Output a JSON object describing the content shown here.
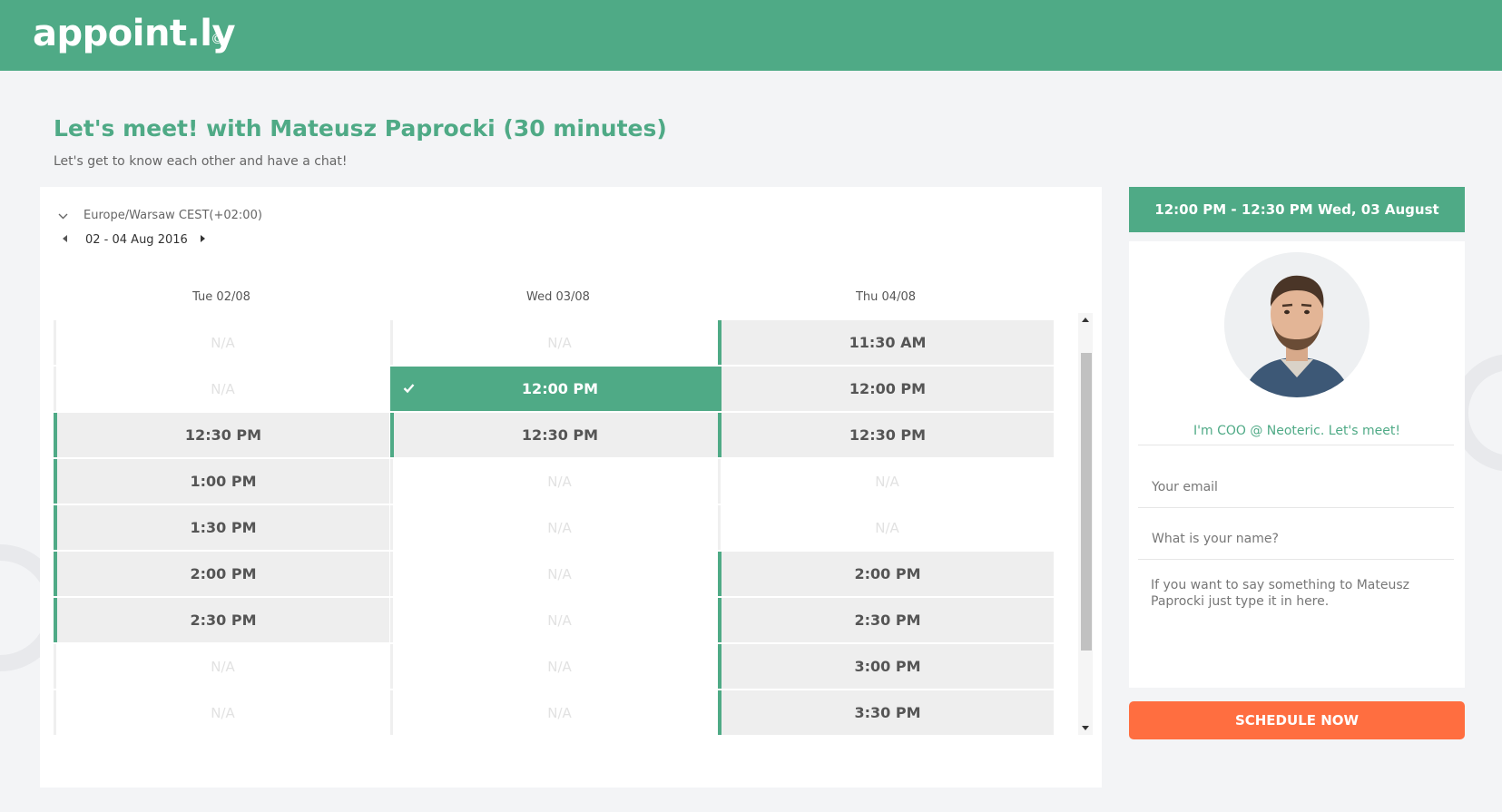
{
  "header": {
    "logo_text": "appoint.ly",
    "logo_mark": "©"
  },
  "page": {
    "title": "Let's meet! with Mateusz Paprocki (30 minutes)",
    "subtitle": "Let's get to know each other and have a chat!"
  },
  "calendar": {
    "timezone": "Europe/Warsaw CEST(+02:00)",
    "date_range": "02 - 04 Aug 2016",
    "days": [
      {
        "label": "Tue 02/08",
        "slots": [
          {
            "label": "N/A",
            "state": "na"
          },
          {
            "label": "N/A",
            "state": "na"
          },
          {
            "label": "12:30 PM",
            "state": "available"
          },
          {
            "label": "1:00 PM",
            "state": "available"
          },
          {
            "label": "1:30 PM",
            "state": "available"
          },
          {
            "label": "2:00 PM",
            "state": "available"
          },
          {
            "label": "2:30 PM",
            "state": "available"
          },
          {
            "label": "N/A",
            "state": "na"
          },
          {
            "label": "N/A",
            "state": "na"
          }
        ]
      },
      {
        "label": "Wed 03/08",
        "slots": [
          {
            "label": "N/A",
            "state": "na"
          },
          {
            "label": "12:00 PM",
            "state": "selected"
          },
          {
            "label": "12:30 PM",
            "state": "available"
          },
          {
            "label": "N/A",
            "state": "na"
          },
          {
            "label": "N/A",
            "state": "na"
          },
          {
            "label": "N/A",
            "state": "na"
          },
          {
            "label": "N/A",
            "state": "na"
          },
          {
            "label": "N/A",
            "state": "na"
          },
          {
            "label": "N/A",
            "state": "na"
          }
        ]
      },
      {
        "label": "Thu 04/08",
        "slots": [
          {
            "label": "11:30 AM",
            "state": "available"
          },
          {
            "label": "12:00 PM",
            "state": "available"
          },
          {
            "label": "12:30 PM",
            "state": "available"
          },
          {
            "label": "N/A",
            "state": "na"
          },
          {
            "label": "N/A",
            "state": "na"
          },
          {
            "label": "2:00 PM",
            "state": "available"
          },
          {
            "label": "2:30 PM",
            "state": "available"
          },
          {
            "label": "3:00 PM",
            "state": "available"
          },
          {
            "label": "3:30 PM",
            "state": "available"
          }
        ]
      }
    ]
  },
  "booking": {
    "summary": "12:00 PM - 12:30 PM Wed, 03 August",
    "bio": "I'm COO @ Neoteric. Let's meet!",
    "email_placeholder": "Your email",
    "name_placeholder": "What is your name?",
    "message_placeholder": "If you want to say something to Mateusz Paprocki just type it in here.",
    "button_label": "SCHEDULE NOW"
  },
  "colors": {
    "brand": "#4faa86",
    "accent": "#ff6e40",
    "background": "#f3f4f6"
  },
  "icons": [
    "chevron-down-icon",
    "caret-left-icon",
    "caret-right-icon",
    "check-icon"
  ]
}
